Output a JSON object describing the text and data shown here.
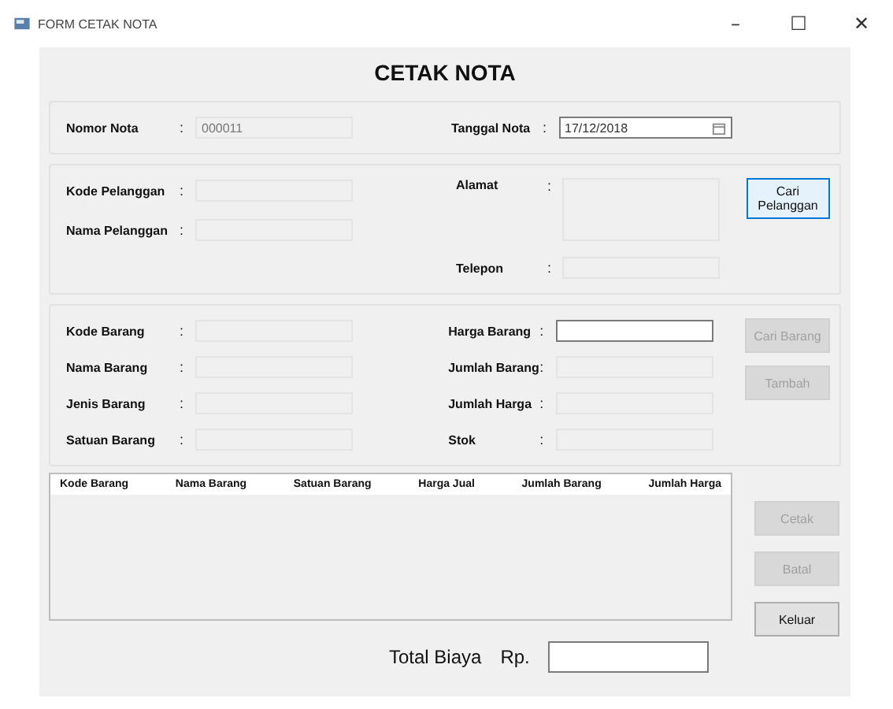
{
  "window": {
    "title": "FORM CETAK NOTA",
    "controls": [
      "–",
      "☐",
      "✕"
    ]
  },
  "heading": "CETAK NOTA",
  "nota": {
    "left": {
      "label": "Nomor Nota",
      "colon": ":",
      "value": "000011",
      "disabled": true
    },
    "right": {
      "label": "Tanggal Nota",
      "colon": ":",
      "value": "17/12/2018",
      "kind": "date",
      "disabled": false
    }
  },
  "pelanggan": {
    "left": [
      {
        "label": "Kode Pelanggan",
        "colon": ":",
        "disabled": true
      },
      {
        "label": "Nama Pelanggan",
        "colon": ":",
        "disabled": true
      }
    ],
    "right": [
      {
        "label": "Alamat",
        "colon": ":",
        "kind": "textarea",
        "disabled": true
      },
      {
        "label": "Telepon",
        "colon": ":",
        "disabled": true
      }
    ],
    "button": {
      "label": "Cari Pelanggan",
      "disabled": false
    }
  },
  "barang": {
    "left": [
      {
        "label": "Kode Barang",
        "colon": ":",
        "disabled": true
      },
      {
        "label": "Nama Barang",
        "colon": ":",
        "disabled": true
      },
      {
        "label": "Jenis Barang",
        "colon": ":",
        "disabled": true
      },
      {
        "label": "Satuan Barang",
        "colon": ":",
        "disabled": true
      }
    ],
    "right": [
      {
        "label": "Harga Barang",
        "colon": ":",
        "disabled": false
      },
      {
        "label": "Jumlah Barang",
        "colon": ":",
        "disabled": true
      },
      {
        "label": "Jumlah Harga",
        "colon": ":",
        "disabled": true
      },
      {
        "label": "Stok",
        "colon": ":",
        "disabled": true
      }
    ],
    "buttons": [
      {
        "label": "Cari Barang",
        "disabled": true
      },
      {
        "label": "Tambah",
        "disabled": true
      }
    ]
  },
  "table": {
    "columns": [
      "Kode Barang",
      "Nama Barang",
      "Satuan Barang",
      "Harga Jual",
      "Jumlah Barang",
      "Jumlah Harga"
    ]
  },
  "side_buttons": [
    {
      "label": "Cetak",
      "disabled": true
    },
    {
      "label": "Batal",
      "disabled": true
    },
    {
      "label": "Keluar",
      "disabled": false
    }
  ],
  "total": {
    "label": "Total Biaya",
    "currency": "Rp.",
    "disabled": false
  }
}
